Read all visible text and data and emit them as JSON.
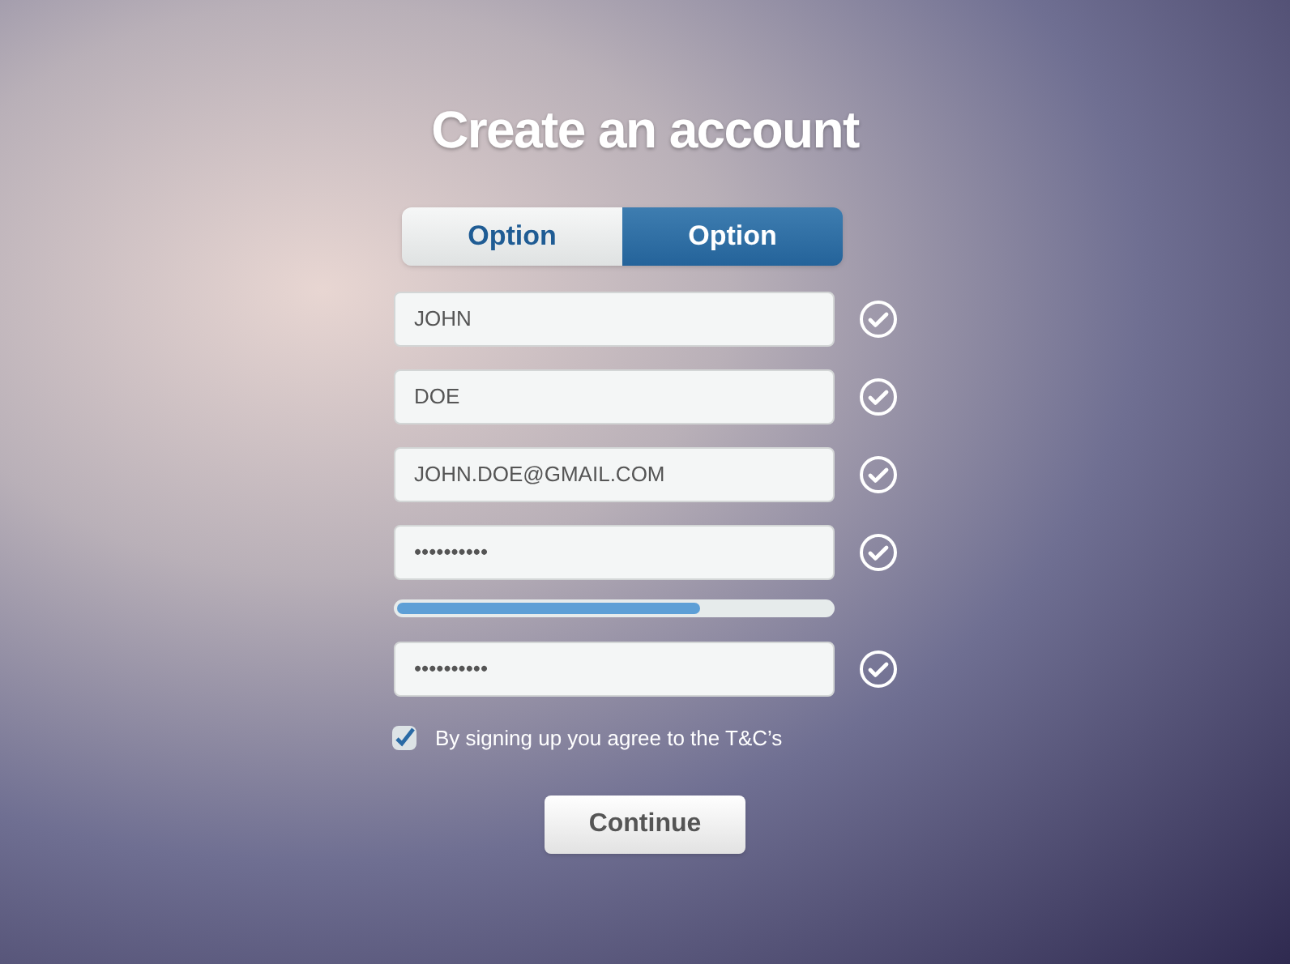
{
  "title": "Create an account",
  "toggle": [
    {
      "label": "Option",
      "selected": false
    },
    {
      "label": "Option",
      "selected": true
    }
  ],
  "rows": [
    {
      "kind": "field",
      "value": "JOHN",
      "valid": true
    },
    {
      "kind": "field",
      "value": "DOE",
      "valid": true
    },
    {
      "kind": "field",
      "value": "JOHN.DOE@GMAIL.COM",
      "valid": true
    },
    {
      "kind": "field",
      "value": "••••••••••",
      "valid": true
    },
    {
      "kind": "meter",
      "level": 0.7
    },
    {
      "kind": "field",
      "value": "••••••••••",
      "valid": true
    }
  ],
  "terms": {
    "label": "By signing up you agree to the T&C’s",
    "checked": true
  },
  "button": "Continue"
}
